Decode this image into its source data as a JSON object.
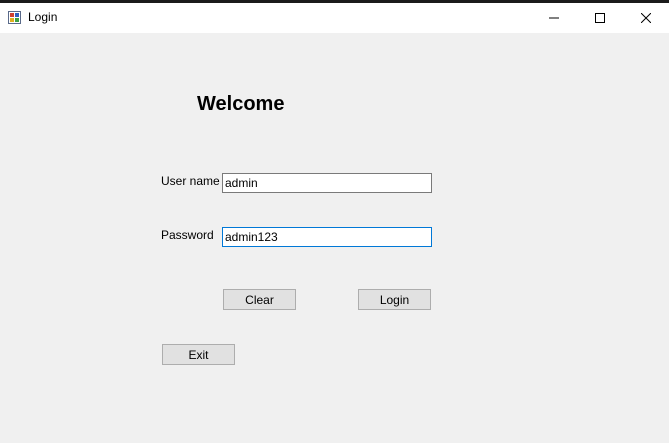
{
  "window": {
    "title": "Login"
  },
  "form": {
    "heading": "Welcome",
    "username_label": "User name",
    "username_value": "admin",
    "password_label": "Password",
    "password_value": "admin123"
  },
  "buttons": {
    "clear_label": "Clear",
    "login_label": "Login",
    "exit_label": "Exit"
  },
  "colors": {
    "background": "#f0f0f0",
    "titlebar": "#ffffff",
    "focus_border": "#0078d7",
    "button_face": "#e1e1e1"
  },
  "icons": {
    "app": "app-icon",
    "minimize": "minimize-icon",
    "maximize": "maximize-icon",
    "close": "close-icon"
  }
}
